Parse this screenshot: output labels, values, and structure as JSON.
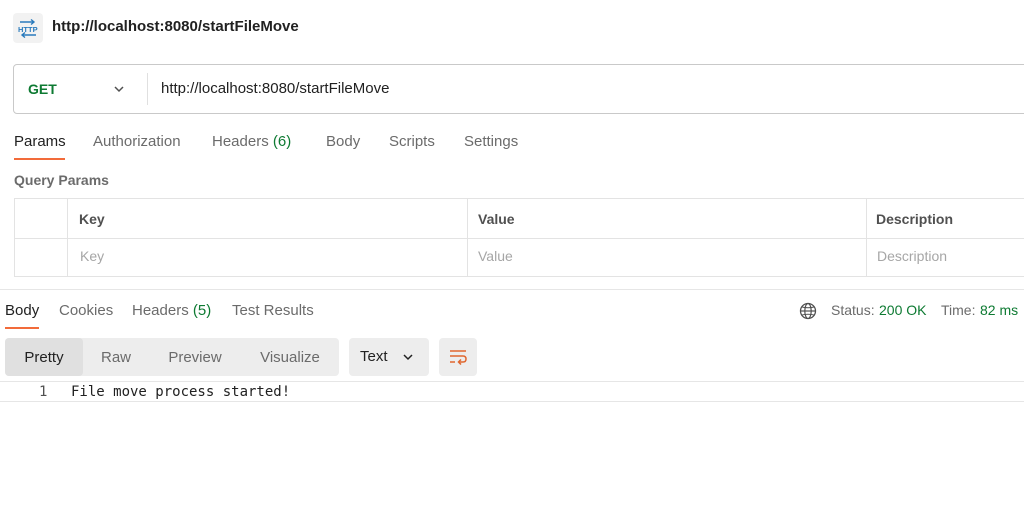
{
  "request": {
    "title": "http://localhost:8080/startFileMove",
    "icon": "http-icon",
    "method": "GET",
    "url": "http://localhost:8080/startFileMove"
  },
  "request_tabs": {
    "params": "Params",
    "authorization": "Authorization",
    "headers": "Headers",
    "headers_count": "(6)",
    "body": "Body",
    "scripts": "Scripts",
    "settings": "Settings",
    "active": "Params"
  },
  "query_params": {
    "label": "Query Params",
    "columns": [
      "Key",
      "Value",
      "Description"
    ],
    "placeholders": [
      "Key",
      "Value",
      "Description"
    ]
  },
  "response_tabs": {
    "body": "Body",
    "cookies": "Cookies",
    "headers": "Headers",
    "headers_count": "(5)",
    "test_results": "Test Results",
    "active": "Body"
  },
  "status": {
    "status_label": "Status:",
    "status_value": "200 OK",
    "time_label": "Time:",
    "time_value": "82 ms"
  },
  "format": {
    "modes": [
      "Pretty",
      "Raw",
      "Preview",
      "Visualize"
    ],
    "active": "Pretty",
    "language": "Text"
  },
  "response_body": {
    "lines": [
      {
        "number": "1",
        "text": "File move process started!"
      }
    ]
  },
  "colors": {
    "accent": "#f26b3a",
    "success": "#0d7a32"
  }
}
